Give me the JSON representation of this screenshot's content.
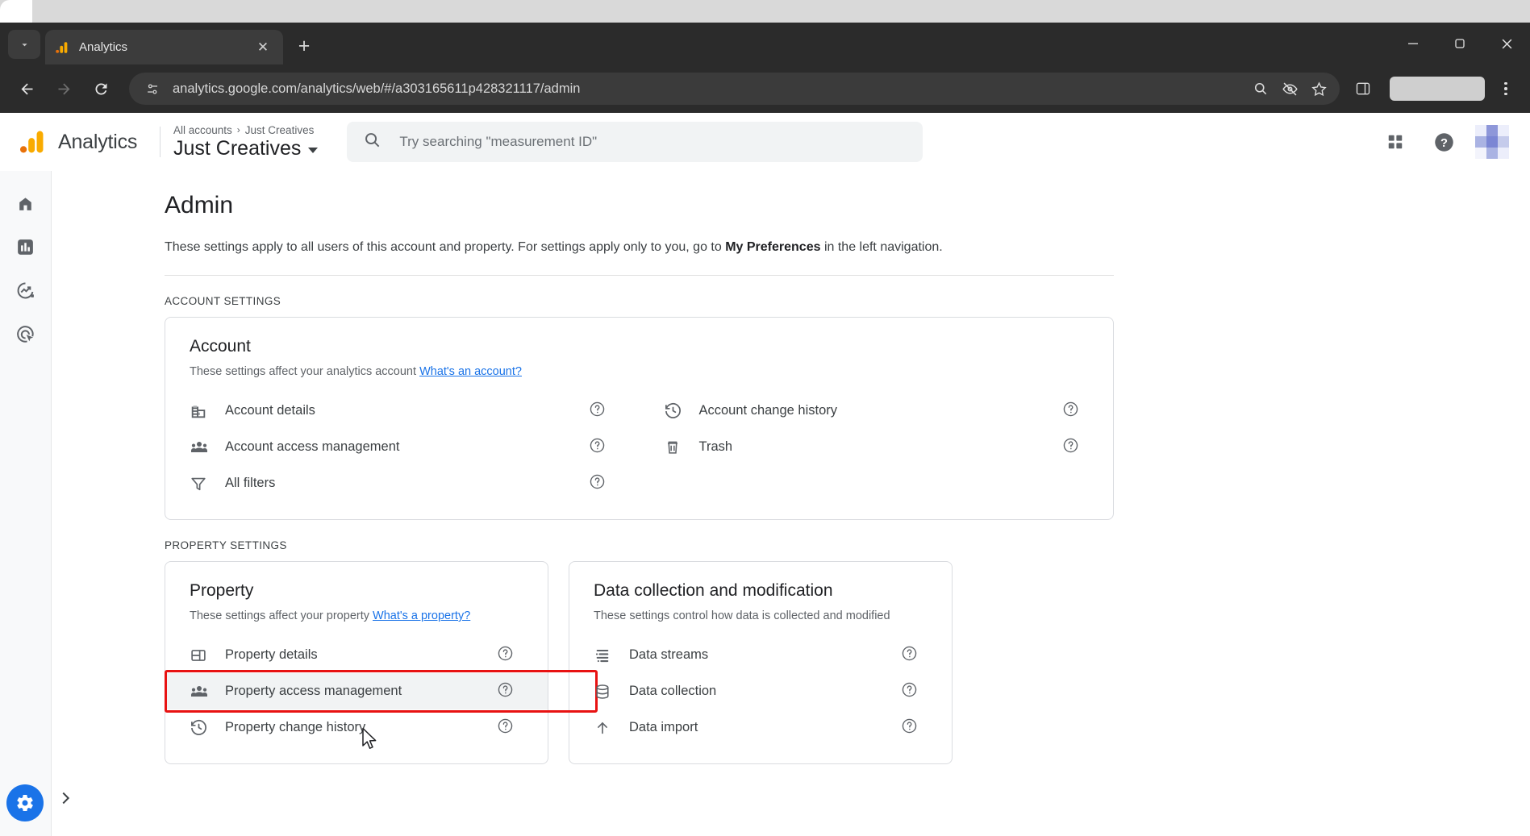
{
  "browser": {
    "tab": {
      "title": "Analytics",
      "favicon": "analytics-favicon",
      "close_label": "✕"
    },
    "new_tab_label": "+",
    "window_controls": {
      "minimize": "minimize-icon",
      "maximize": "maximize-icon",
      "close": "close-icon"
    },
    "nav": {
      "back": "back-arrow-icon",
      "forward": "forward-arrow-icon",
      "reload": "reload-icon"
    },
    "omnibox": {
      "url": "analytics.google.com/analytics/web/#/a303165611p428321117/admin",
      "site_info_icon": "site-settings-icon",
      "actions": [
        "zoom-search-icon",
        "hidden-eye-icon",
        "bookmark-star-icon"
      ]
    },
    "toolbar_right": {
      "side_panel": "side-panel-icon",
      "profile": "profile-pill",
      "menu": "three-dot-menu-icon"
    }
  },
  "ga_header": {
    "logo": "google-analytics-logo",
    "wordmark": "Analytics",
    "breadcrumb": {
      "root": "All accounts",
      "separator": "›",
      "current": "Just Creatives"
    },
    "property_name": "Just Creatives",
    "search": {
      "placeholder": "Try searching \"measurement ID\"",
      "value": "",
      "icon": "search-icon"
    },
    "right_icons": [
      "apps-grid-icon",
      "help-circle-icon",
      "avatar"
    ]
  },
  "rail": {
    "items": [
      {
        "name": "home",
        "icon": "home-icon",
        "active": false
      },
      {
        "name": "reports",
        "icon": "bar-chart-icon",
        "active": false
      },
      {
        "name": "explore",
        "icon": "explore-trending-icon",
        "active": false
      },
      {
        "name": "advertising",
        "icon": "advertising-target-icon",
        "active": false
      }
    ],
    "admin_fab": "gear-icon",
    "expand": "chevron-right-icon"
  },
  "page": {
    "title": "Admin",
    "description_pre": "These settings apply to all users of this account and property. For settings apply only to you, go to ",
    "description_bold": "My Preferences",
    "description_post": " in the left navigation."
  },
  "account_section": {
    "label": "ACCOUNT SETTINGS",
    "card": {
      "title": "Account",
      "subtitle": "These settings affect your analytics account ",
      "link": "What's an account?",
      "left_rows": [
        {
          "label": "Account details",
          "icon": "building-icon",
          "help": "help-circle-icon"
        },
        {
          "label": "Account access management",
          "icon": "people-group-icon",
          "help": "help-circle-icon"
        },
        {
          "label": "All filters",
          "icon": "filter-funnel-icon",
          "help": "help-circle-icon"
        }
      ],
      "right_rows": [
        {
          "label": "Account change history",
          "icon": "history-clock-icon",
          "help": "help-circle-icon"
        },
        {
          "label": "Trash",
          "icon": "trash-icon",
          "help": "help-circle-icon"
        }
      ]
    }
  },
  "property_section": {
    "label": "PROPERTY SETTINGS",
    "property_card": {
      "title": "Property",
      "subtitle": "These settings affect your property ",
      "link": "What's a property?",
      "rows": [
        {
          "label": "Property details",
          "icon": "property-details-icon",
          "help": "help-circle-icon",
          "highlighted": false
        },
        {
          "label": "Property access management",
          "icon": "people-group-icon",
          "help": "help-circle-icon",
          "highlighted": true
        },
        {
          "label": "Property change history",
          "icon": "history-clock-icon",
          "help": "help-circle-icon",
          "highlighted": false
        }
      ]
    },
    "data_card": {
      "title": "Data collection and modification",
      "subtitle": "These settings control how data is collected and modified",
      "rows": [
        {
          "label": "Data streams",
          "icon": "data-streams-icon",
          "help": "help-circle-icon"
        },
        {
          "label": "Data collection",
          "icon": "database-icon",
          "help": "help-circle-icon"
        },
        {
          "label": "Data import",
          "icon": "upload-icon",
          "help": "help-circle-icon"
        }
      ]
    }
  },
  "colors": {
    "accent_blue": "#1a73e8",
    "highlight_border": "#e81212",
    "ga_orange": "#f9ab00",
    "ga_orange_dark": "#e8710a",
    "text_primary": "#202124",
    "text_secondary": "#5f6368"
  }
}
